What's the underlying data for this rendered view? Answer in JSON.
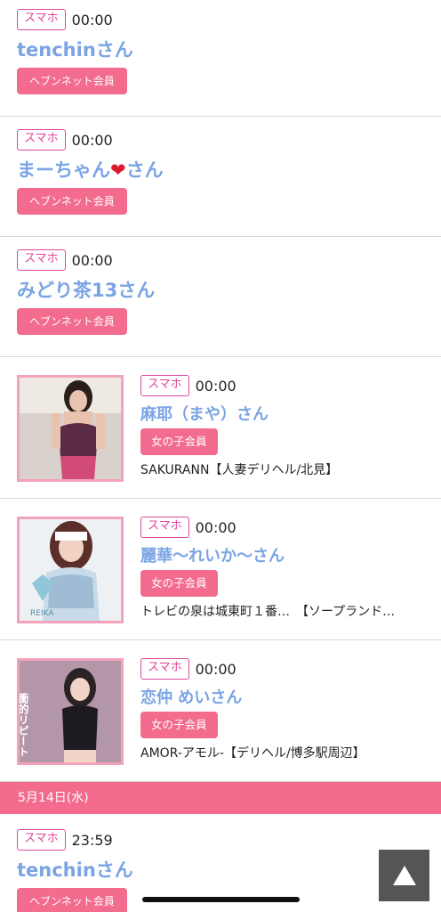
{
  "entries": [
    {
      "device": "スマホ",
      "time": "00:00",
      "name": "tenchinさん",
      "member": "ヘブンネット会員"
    },
    {
      "device": "スマホ",
      "time": "00:00",
      "name_prefix": "まーちゃん",
      "name_heart": "❤",
      "name_suffix": "さん",
      "member": "ヘブンネット会員"
    },
    {
      "device": "スマホ",
      "time": "00:00",
      "name": "みどり茶13さん",
      "member": "ヘブンネット会員"
    },
    {
      "device": "スマホ",
      "time": "00:00",
      "name": "麻耶（まや）さん",
      "member": "女の子会員",
      "shop": "SAKURANN【人妻デリヘル/北見】"
    },
    {
      "device": "スマホ",
      "time": "00:00",
      "name": "麗華〜れいか〜さん",
      "member": "女の子会員",
      "shop": "トレビの泉は城東町１番…　【ソープランド…"
    },
    {
      "device": "スマホ",
      "time": "00:00",
      "name": "恋仲 めいさん",
      "member": "女の子会員",
      "shop": "AMOR-アモル-【デリヘル/博多駅周辺】"
    },
    {
      "device": "スマホ",
      "time": "23:59",
      "name": "tenchinさん",
      "member": "ヘブンネット会員"
    }
  ],
  "date_header": "5月14日(水)",
  "thumb_texts": {
    "t2": "REIKA",
    "t3": "衝的リピート"
  },
  "colors": {
    "accent_pink": "#f36b8d",
    "device_border": "#e0469a",
    "name_blue": "#7aa4e4"
  }
}
